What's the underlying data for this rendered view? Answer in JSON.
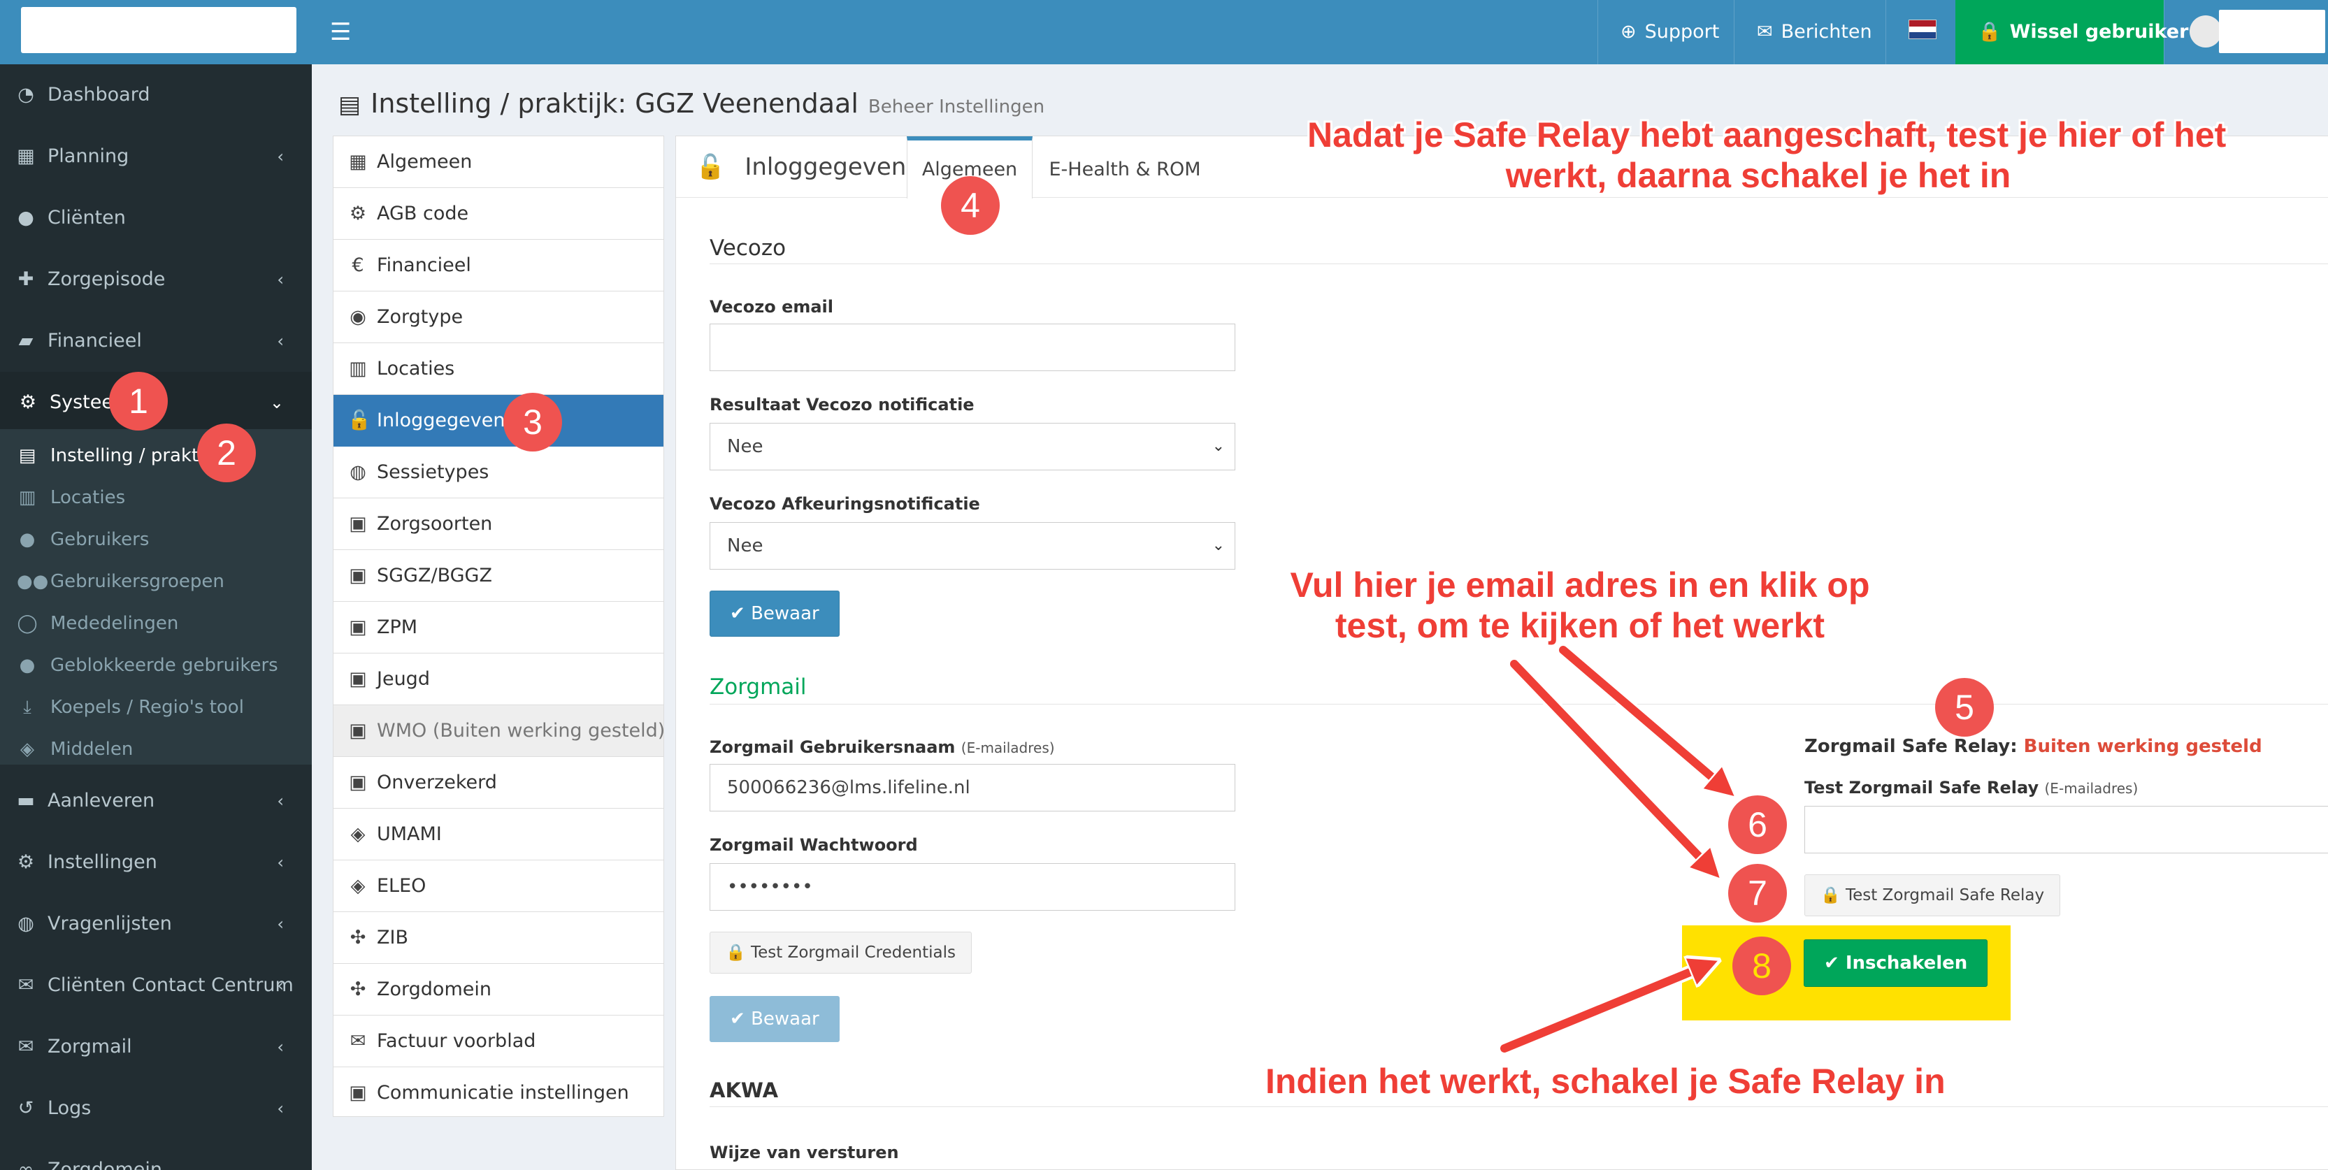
{
  "topbar": {
    "support": "Support",
    "berichten": "Berichten",
    "wissel": "Wissel gebruiker"
  },
  "sidebar": {
    "items": [
      {
        "label": "Dashboard",
        "icon": "dashboard-icon"
      },
      {
        "label": "Planning",
        "icon": "calendar-icon"
      },
      {
        "label": "Cliënten",
        "icon": "user-icon"
      },
      {
        "label": "Zorgepisode",
        "icon": "medkit-icon"
      },
      {
        "label": "Financieel",
        "icon": "book-icon"
      },
      {
        "label": "Systeem",
        "icon": "cogs-icon"
      },
      {
        "label": "Aanleveren",
        "icon": "truck-icon"
      },
      {
        "label": "Instellingen",
        "icon": "gear-icon"
      },
      {
        "label": "Vragenlijsten",
        "icon": "globe-icon"
      },
      {
        "label": "Cliënten Contact Centrum",
        "icon": "envelope-icon"
      },
      {
        "label": "Zorgmail",
        "icon": "envelope-icon"
      },
      {
        "label": "Logs",
        "icon": "history-icon"
      },
      {
        "label": "Zorgdomein",
        "icon": "link-icon"
      }
    ],
    "subitems": [
      {
        "label": "Instelling / praktijk",
        "icon": "building-icon"
      },
      {
        "label": "Locaties",
        "icon": "map-icon"
      },
      {
        "label": "Gebruikers",
        "icon": "user-icon"
      },
      {
        "label": "Gebruikersgroepen",
        "icon": "users-icon"
      },
      {
        "label": "Mededelingen",
        "icon": "comment-icon"
      },
      {
        "label": "Geblokkeerde gebruikers",
        "icon": "user-lock-icon"
      },
      {
        "label": "Koepels / Regio's tool",
        "icon": "download-icon"
      },
      {
        "label": "Middelen",
        "icon": "cubes-icon"
      }
    ]
  },
  "page": {
    "title": "Instelling / praktijk: GGZ Veenendaal",
    "subtitle": "Beheer Instellingen"
  },
  "settings_list": [
    {
      "label": "Algemeen",
      "icon": "table-icon"
    },
    {
      "label": "AGB code",
      "icon": "cogs-icon"
    },
    {
      "label": "Financieel",
      "icon": "euro-icon"
    },
    {
      "label": "Zorgtype",
      "icon": "accessibility-icon"
    },
    {
      "label": "Locaties",
      "icon": "map-icon"
    },
    {
      "label": "Inloggegevens",
      "icon": "unlock-icon"
    },
    {
      "label": "Sessietypes",
      "icon": "globe-icon"
    },
    {
      "label": "Zorgsoorten",
      "icon": "briefcase-icon"
    },
    {
      "label": "SGGZ/BGGZ",
      "icon": "briefcase-icon"
    },
    {
      "label": "ZPM",
      "icon": "briefcase-icon"
    },
    {
      "label": "Jeugd",
      "icon": "briefcase-icon"
    },
    {
      "label": "WMO (Buiten werking gesteld)",
      "icon": "briefcase-icon"
    },
    {
      "label": "Onverzekerd",
      "icon": "briefcase-icon"
    },
    {
      "label": "UMAMI",
      "icon": "cubes-icon"
    },
    {
      "label": "ELEO",
      "icon": "cubes-icon"
    },
    {
      "label": "ZIB",
      "icon": "puzzle-icon"
    },
    {
      "label": "Zorgdomein",
      "icon": "puzzle-icon"
    },
    {
      "label": "Factuur voorblad",
      "icon": "envelope-icon"
    },
    {
      "label": "Communicatie instellingen",
      "icon": "briefcase-icon"
    }
  ],
  "tabs": {
    "title": "Inloggegevens",
    "algemeen": "Algemeen",
    "ehealth": "E-Health & ROM"
  },
  "vecozo": {
    "heading": "Vecozo",
    "email_label": "Vecozo email",
    "email_value": "",
    "notificatie_label": "Resultaat Vecozo notificatie",
    "notificatie_value": "Nee",
    "afkeuring_label": "Vecozo Afkeuringsnotificatie",
    "afkeuring_value": "Nee",
    "save": "Bewaar"
  },
  "zorgmail": {
    "heading": "Zorgmail",
    "user_label": "Zorgmail Gebruikersnaam",
    "user_hint": "(E-mailadres)",
    "user_value": "500066236@lms.lifeline.nl",
    "pass_label": "Zorgmail Wachtwoord",
    "pass_value": "••••••••",
    "test_credentials": "Test Zorgmail Credentials",
    "save": "Bewaar",
    "relay_label": "Zorgmail Safe Relay:",
    "relay_status": "Buiten werking gesteld",
    "test_relay_label": "Test Zorgmail Safe Relay",
    "test_relay_hint": "(E-mailadres)",
    "test_relay_value": "",
    "test_relay_button": "Test Zorgmail Safe Relay",
    "enable_button": "Inschakelen"
  },
  "akwa": {
    "heading": "AKWA",
    "wijze_label": "Wijze van versturen"
  },
  "annotations": {
    "top_line1": "Nadat je Safe Relay hebt aangeschaft, test je hier of het",
    "top_line2": "werkt, daarna schakel je het in",
    "mid_line1": "Vul hier je email adres in en klik op",
    "mid_line2": "test, om te kijken of het werkt",
    "bottom": "Indien het werkt, schakel je Safe Relay in",
    "steps": [
      "1",
      "2",
      "3",
      "4",
      "5",
      "6",
      "7",
      "8"
    ]
  },
  "colors": {
    "topbar": "#3c8dbc",
    "sidebar": "#222d32",
    "success": "#00a65a",
    "annotation_red": "#ef3e36",
    "highlight_yellow": "#ffe100",
    "status_red": "#dd4b39",
    "zorgmail_green": "#00a65a"
  }
}
